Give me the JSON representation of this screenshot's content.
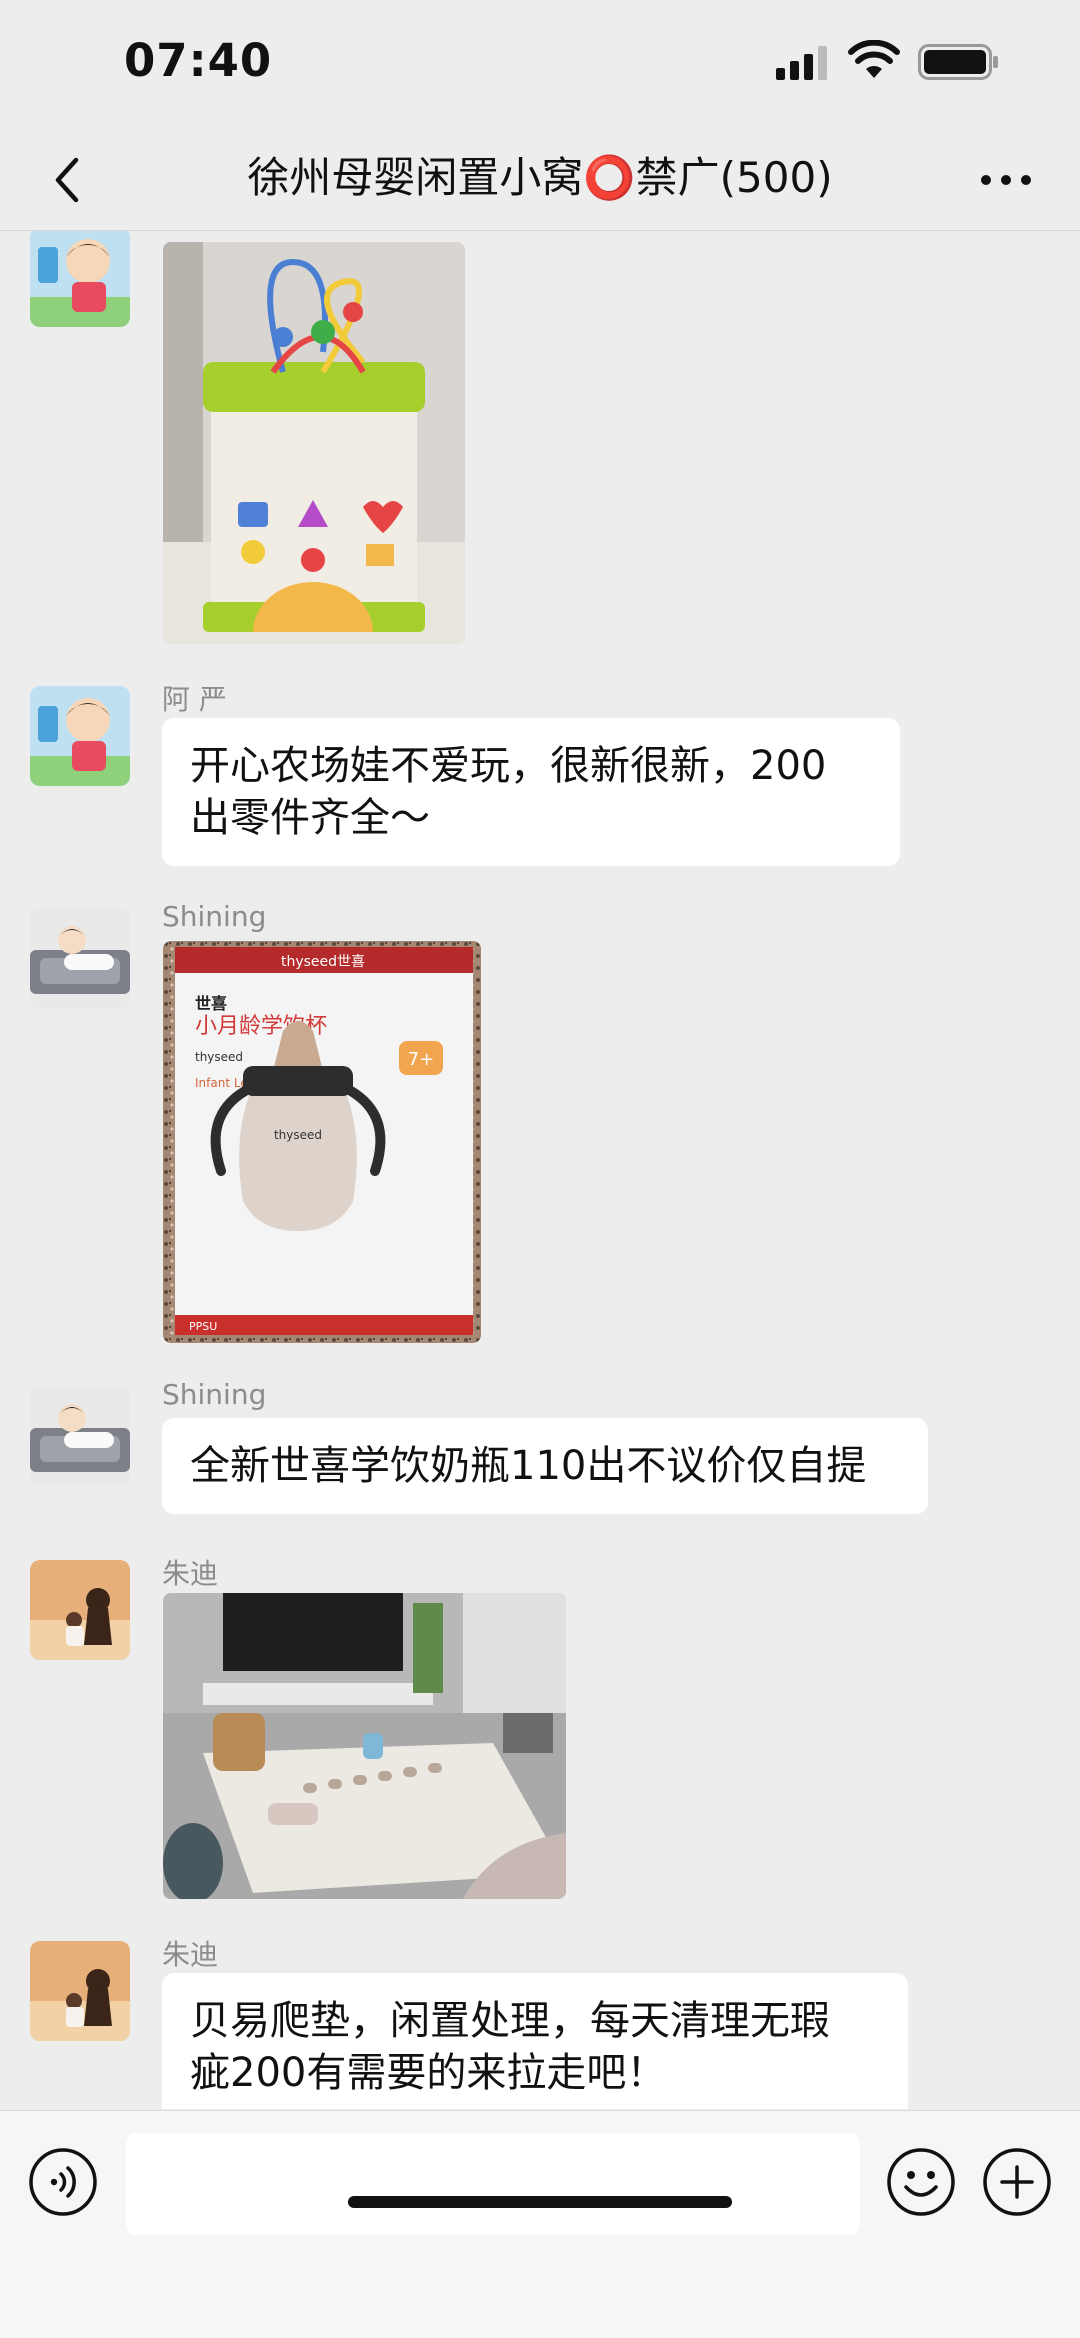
{
  "status_bar": {
    "time": "07:40"
  },
  "nav": {
    "title": "徐州母婴闲置小窝⭕禁广(500)"
  },
  "messages": [
    {
      "sender": "阿 严",
      "type": "image",
      "image_icon": "activity-cube-toy-photo"
    },
    {
      "sender": "阿 严",
      "type": "text",
      "text_line1": "开心农场娃不爱玩，很新很新，200",
      "text_line2": "出零件齐全～"
    },
    {
      "sender": "Shining",
      "type": "image",
      "image_icon": "sippy-cup-box-photo",
      "box": {
        "brand": "thyseed世喜",
        "brand_cn": "世喜",
        "product": "小月龄学饮杯",
        "brand_en": "thyseed",
        "desc": "Infant Learner Cup",
        "age": "7+",
        "material": "PPSU"
      }
    },
    {
      "sender": "Shining",
      "type": "text",
      "text": "全新世喜学饮奶瓶110出不议价仅自提"
    },
    {
      "sender": "朱迪",
      "type": "image",
      "image_icon": "play-mat-living-room-photo"
    },
    {
      "sender": "朱迪",
      "type": "text",
      "text_line1": "贝易爬垫，闲置处理，每天清理无瑕",
      "text_line2": "疵200有需要的来拉走吧！"
    }
  ],
  "input": {
    "placeholder": ""
  }
}
